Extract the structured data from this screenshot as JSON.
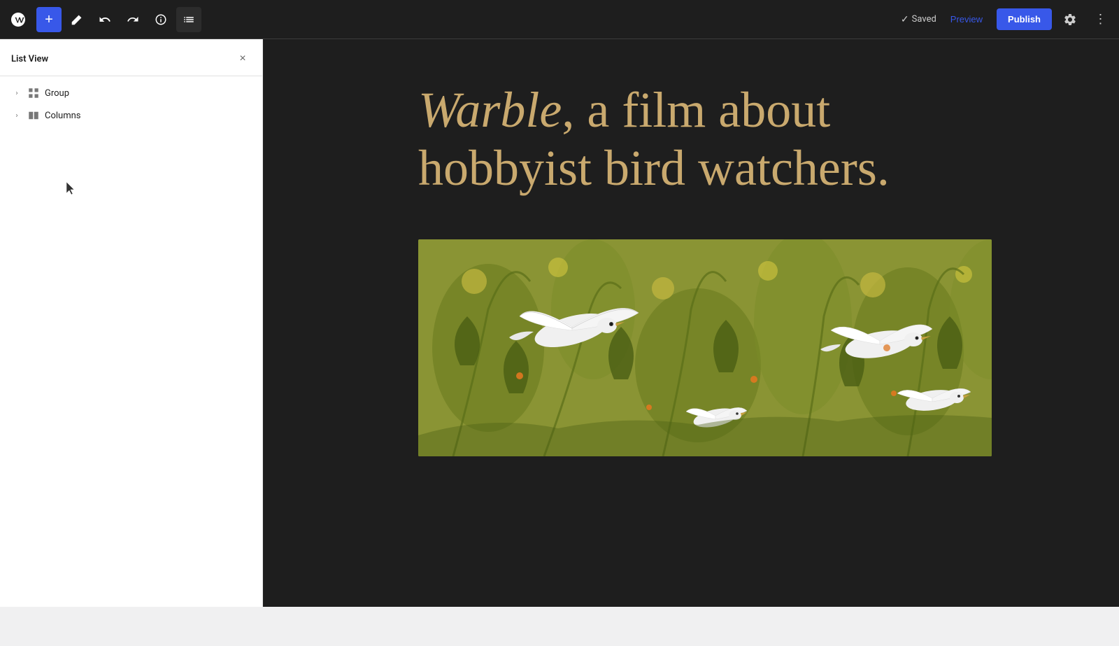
{
  "toolbar": {
    "wp_logo_label": "WordPress",
    "add_label": "+",
    "edit_label": "Edit",
    "undo_label": "Undo",
    "redo_label": "Redo",
    "details_label": "Details",
    "list_view_label": "List View",
    "saved_label": "Saved",
    "preview_label": "Preview",
    "publish_label": "Publish",
    "settings_label": "Settings",
    "more_label": "More"
  },
  "list_view": {
    "title": "List View",
    "close_label": "×",
    "items": [
      {
        "label": "Group",
        "icon": "group-icon",
        "has_children": true
      },
      {
        "label": "Columns",
        "icon": "columns-icon",
        "has_children": true
      }
    ]
  },
  "editor": {
    "hero_title_italic": "Warble",
    "hero_title_rest": ", a film about hobbyist bird watchers.",
    "image_alt": "Decorative floral pattern with white birds"
  },
  "colors": {
    "accent": "#3858e9",
    "text_gold": "#c9a96e",
    "toolbar_bg": "#1e1e1e",
    "editor_bg": "#1e1e1e",
    "panel_bg": "#ffffff"
  }
}
